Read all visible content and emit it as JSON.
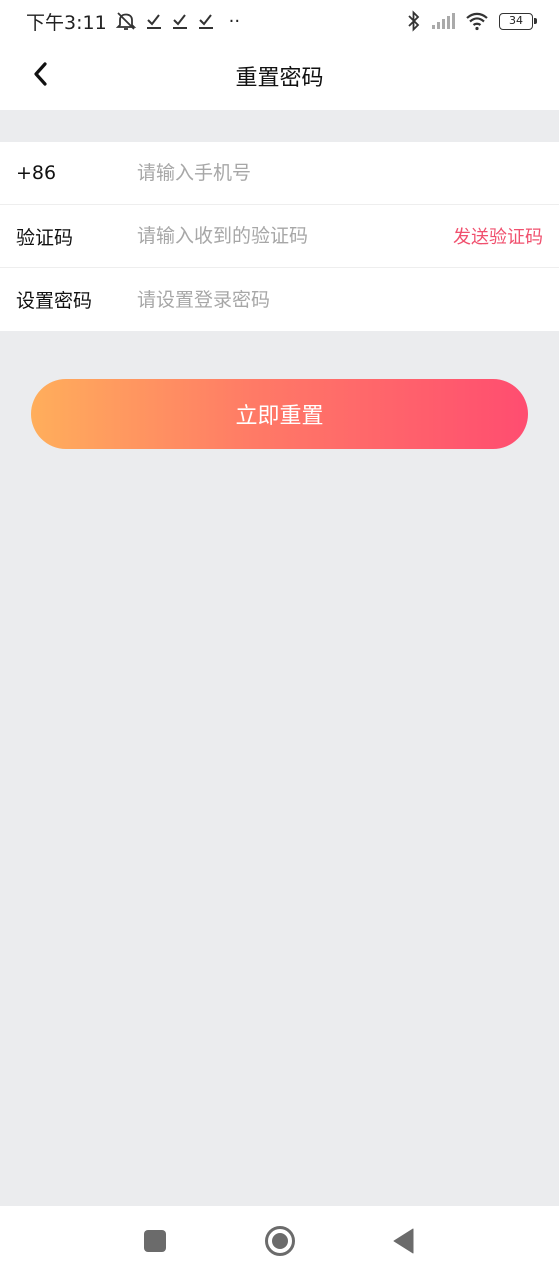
{
  "status_bar": {
    "time": "下午3:11",
    "dots": "··",
    "battery_level": "34",
    "icons": [
      "mute-bell-icon",
      "check-icon",
      "check-icon",
      "check-icon",
      "bluetooth-icon",
      "signal-icon",
      "wifi-icon",
      "battery-icon"
    ]
  },
  "nav": {
    "title": "重置密码",
    "back_icon": "chevron-left-icon"
  },
  "form": {
    "phone": {
      "label": "+86",
      "placeholder": "请输入手机号",
      "value": ""
    },
    "code": {
      "label": "验证码",
      "placeholder": "请输入收到的验证码",
      "value": "",
      "send_label": "发送验证码"
    },
    "password": {
      "label": "设置密码",
      "placeholder": "请设置登录密码",
      "value": ""
    }
  },
  "reset_button": {
    "label": "立即重置"
  },
  "colors": {
    "accent": "#f0506e",
    "gradient_start": "#ffae5b",
    "gradient_end": "#ff4d70",
    "background": "#ebecee"
  },
  "system_nav": {
    "icons": [
      "recent-apps-icon",
      "home-icon",
      "back-triangle-icon"
    ]
  }
}
